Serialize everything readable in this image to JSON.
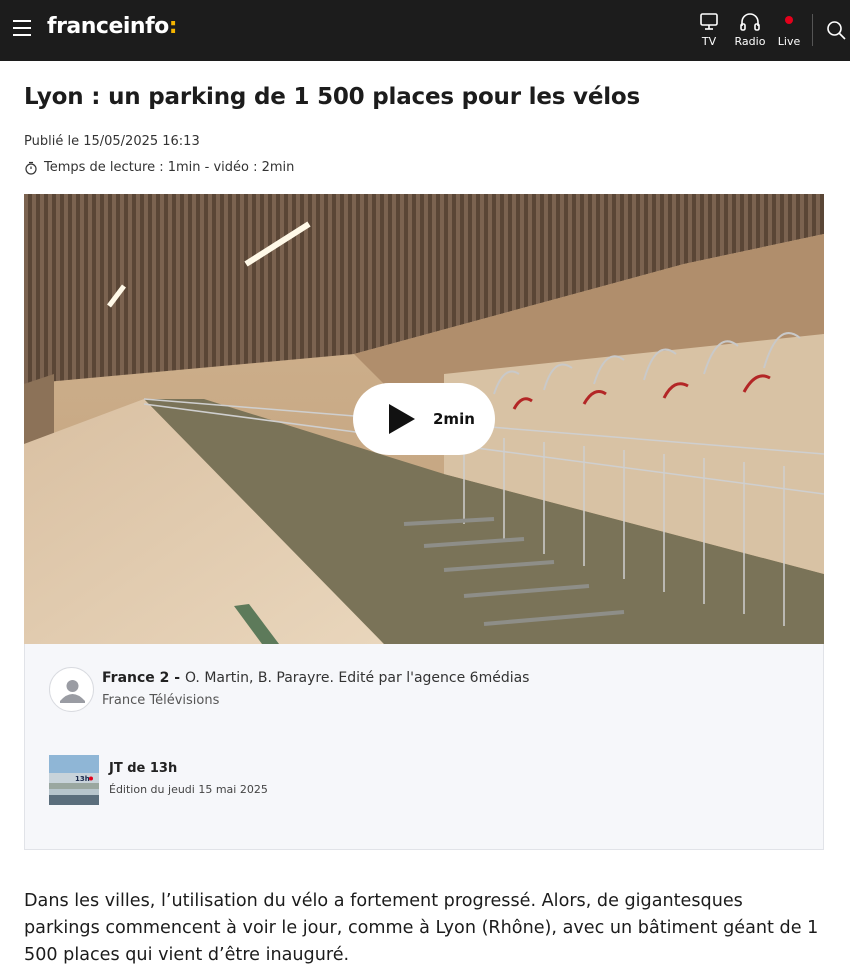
{
  "header": {
    "logo_text": "franceinfo",
    "logo_colon": ":",
    "nav": [
      {
        "label": "TV",
        "icon": "tv-icon"
      },
      {
        "label": "Radio",
        "icon": "headphones-icon"
      },
      {
        "label": "Live",
        "icon": "live-dot-icon"
      }
    ],
    "search_icon": "search-icon",
    "menu_icon": "hamburger-menu-icon"
  },
  "article": {
    "title": "Lyon : un parking de 1 500 places pour les vélos",
    "published": "Publié le 15/05/2025 16:13",
    "reading_time": "Temps de lecture : 1min - vidéo : 2min",
    "video": {
      "duration": "2min"
    },
    "credits": {
      "author_channel": "France 2",
      "author_separator": " - ",
      "author_names": "O. Martin, B. Parayre. Edité par l'agence 6médias",
      "organization": "France Télévisions"
    },
    "show": {
      "name": "JT de 13h",
      "edition": "Édition du jeudi 15 mai 2025",
      "thumb_text": "13h"
    },
    "paragraph": "Dans les villes, l’utilisation du vélo a fortement progressé. Alors, de gigantesques parkings commencent à voir le jour, comme à Lyon (Rhône), avec un bâtiment géant de 1 500 places qui vient d’être inauguré."
  },
  "colors": {
    "header_bg": "#1c1c1c",
    "logo_colon": "#f5b400",
    "live_dot": "#e4001b",
    "credits_bg": "#f6f7fa"
  }
}
